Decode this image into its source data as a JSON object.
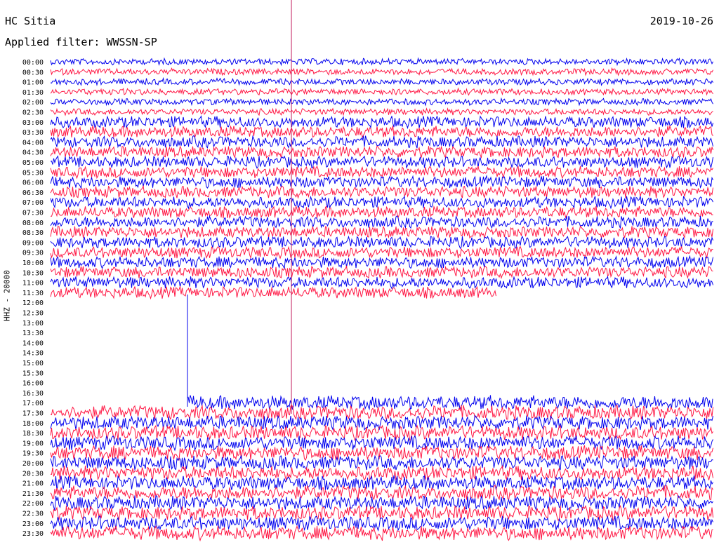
{
  "header": {
    "station": "HC Sitia",
    "filter": "Applied filter: WWSSN-SP",
    "date": "2019-10-26"
  },
  "chart_data": {
    "type": "line",
    "ylabel": "HHZ - 20000",
    "rows": [
      "00:00",
      "00:30",
      "01:00",
      "01:30",
      "02:00",
      "02:30",
      "03:00",
      "03:30",
      "04:00",
      "04:30",
      "05:00",
      "05:30",
      "06:00",
      "06:30",
      "07:00",
      "07:30",
      "08:00",
      "08:30",
      "09:00",
      "09:30",
      "10:00",
      "10:30",
      "11:00",
      "11:30",
      "12:00",
      "12:30",
      "13:00",
      "13:30",
      "14:00",
      "14:30",
      "15:00",
      "15:30",
      "16:00",
      "16:30",
      "17:00",
      "17:30",
      "18:00",
      "18:30",
      "19:00",
      "19:30",
      "20:00",
      "20:30",
      "21:00",
      "21:30",
      "22:00",
      "22:30",
      "23:00",
      "23:30"
    ],
    "trace_colors": [
      "#0000ee",
      "#ff1744"
    ],
    "marker_color": "#c2185b",
    "rows_with_data": [
      [
        0,
        23
      ],
      [
        34,
        47
      ]
    ]
  }
}
